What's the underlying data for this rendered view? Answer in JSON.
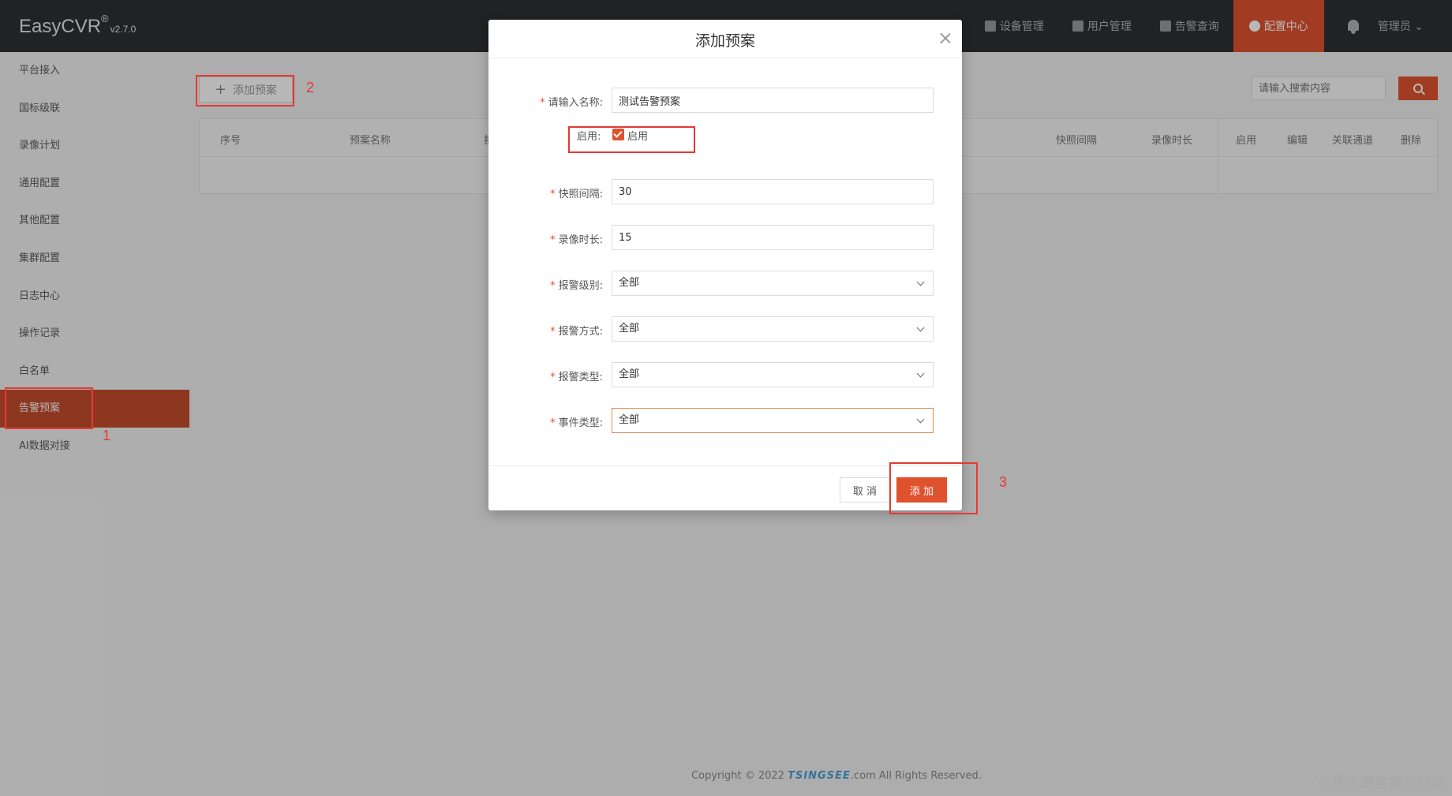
{
  "header": {
    "logo": "EasyCVR",
    "logo_sup": "®",
    "version": "v2.7.0",
    "nav": [
      {
        "label": "设备管理",
        "icon": "device-icon"
      },
      {
        "label": "用户管理",
        "icon": "user-icon"
      },
      {
        "label": "告警查询",
        "icon": "alarm-icon"
      },
      {
        "label": "配置中心",
        "icon": "gear-icon",
        "active": true
      }
    ],
    "user": "管理员 ⌄"
  },
  "sidebar": {
    "items": [
      {
        "label": "平台接入"
      },
      {
        "label": "国标级联"
      },
      {
        "label": "录像计划"
      },
      {
        "label": "通用配置"
      },
      {
        "label": "其他配置"
      },
      {
        "label": "集群配置"
      },
      {
        "label": "日志中心"
      },
      {
        "label": "操作记录"
      },
      {
        "label": "白名单"
      },
      {
        "label": "告警预案",
        "active": true
      },
      {
        "label": "AI数据对接"
      }
    ]
  },
  "toolbar": {
    "add_label": "添加预案",
    "search_placeholder": "请输入搜索内容"
  },
  "table": {
    "columns": [
      "序号",
      "预案名称",
      "报",
      "快照间隔",
      "录像时长",
      "启用",
      "编辑",
      "关联通道",
      "删除"
    ]
  },
  "modal": {
    "title": "添加预案",
    "fields": {
      "name": {
        "label": "请输入名称:",
        "value": "测试告警预案"
      },
      "enable": {
        "label": "启用:",
        "checkbox_text": "启用",
        "checked": true
      },
      "snapshot": {
        "label": "快照间隔:",
        "value": "30"
      },
      "record": {
        "label": "录像时长:",
        "value": "15"
      },
      "alarm_level": {
        "label": "报警级别:",
        "value": "全部"
      },
      "alarm_method": {
        "label": "报警方式:",
        "value": "全部"
      },
      "alarm_type": {
        "label": "报警类型:",
        "value": "全部"
      },
      "event_type": {
        "label": "事件类型:",
        "value": "全部"
      }
    },
    "cancel_label": "取 消",
    "add_label": "添 加"
  },
  "annotations": {
    "n1": "1",
    "n2": "2",
    "n3": "3"
  },
  "footer": {
    "copyright_prefix": "Copyright © 2022 ",
    "brand": "TSINGSEE",
    "copyright_suffix": ".com All Rights Reserved."
  },
  "watermark": "@稀土掘金技术社区",
  "colors": {
    "accent": "#e0522e",
    "annotation": "#e53935",
    "header_bg": "#2f3033"
  }
}
